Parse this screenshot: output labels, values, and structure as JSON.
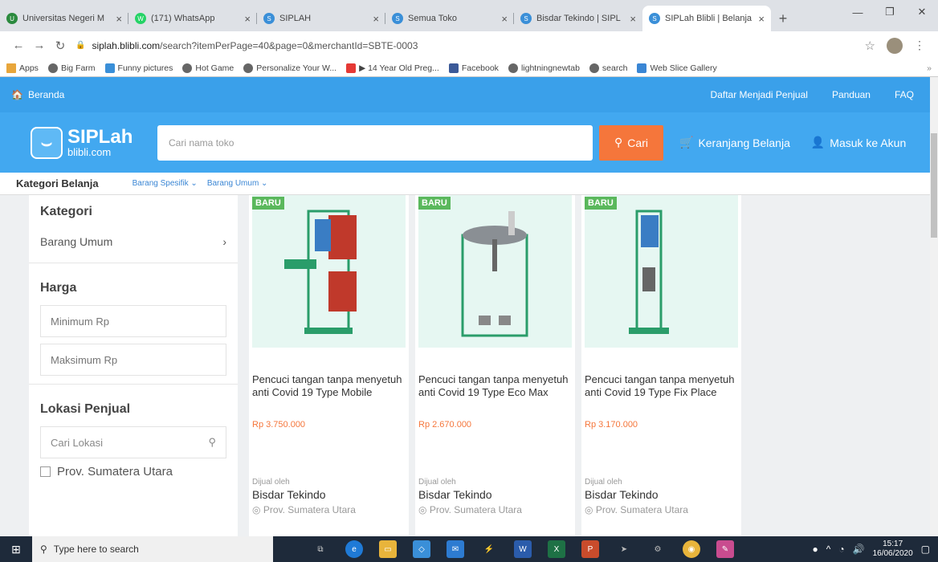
{
  "tabs": [
    {
      "title": "Universitas Negeri M",
      "color": "#2b8a3e",
      "active": false
    },
    {
      "title": "(171) WhatsApp",
      "color": "#25d366",
      "active": false
    },
    {
      "title": "SIPLAH",
      "color": "#3a8fd8",
      "active": false
    },
    {
      "title": "Semua Toko",
      "color": "#3a8fd8",
      "active": false
    },
    {
      "title": "Bisdar Tekindo | SIPL",
      "color": "#3a8fd8",
      "active": false
    },
    {
      "title": "SIPLah Blibli | Belanja",
      "color": "#3a8fd8",
      "active": true
    }
  ],
  "address": {
    "host": "siplah.blibli.com",
    "path": "/search?itemPerPage=40&page=0&merchantId=SBTE-0003"
  },
  "bookmarks": [
    {
      "label": "Apps",
      "color": "#888"
    },
    {
      "label": "Big Farm",
      "color": "#666"
    },
    {
      "label": "Funny pictures",
      "color": "#3a8fd8"
    },
    {
      "label": "Hot Game",
      "color": "#666"
    },
    {
      "label": "Personalize Your W...",
      "color": "#666"
    },
    {
      "label": "▶ 14 Year Old Preg...",
      "color": "#e53935"
    },
    {
      "label": "Facebook",
      "color": "#3b5998"
    },
    {
      "label": "lightningnewtab",
      "color": "#666"
    },
    {
      "label": "search",
      "color": "#666"
    },
    {
      "label": "Web Slice Gallery",
      "color": "#3a86d4"
    }
  ],
  "topnav": {
    "home": "Beranda",
    "links": [
      "Daftar Menjadi Penjual",
      "Panduan",
      "FAQ"
    ]
  },
  "header": {
    "logo_big": "SIPLah",
    "logo_small": "blibli.com",
    "search_placeholder": "Cari nama toko",
    "cari": "Cari",
    "cart": "Keranjang Belanja",
    "login": "Masuk ke Akun"
  },
  "catbar": {
    "title": "Kategori Belanja",
    "dd1": "Barang Spesifik",
    "dd2": "Barang Umum"
  },
  "sidebar": {
    "kategori_title": "Kategori",
    "kategori_item": "Barang Umum",
    "harga_title": "Harga",
    "min_placeholder": "Minimum Rp",
    "max_placeholder": "Maksimum Rp",
    "lokasi_title": "Lokasi Penjual",
    "lokasi_placeholder": "Cari Lokasi",
    "province": "Prov. Sumatera Utara"
  },
  "products": [
    {
      "badge": "BARU",
      "name": "Pencuci tangan tanpa menyetuh anti Covid 19 Type Mobile",
      "price": "Rp 3.750.000",
      "seller_label": "Dijual oleh",
      "seller": "Bisdar Tekindo",
      "location": "Prov. Sumatera Utara"
    },
    {
      "badge": "BARU",
      "name": "Pencuci tangan tanpa menyetuh anti Covid 19 Type Eco Max",
      "price": "Rp 2.670.000",
      "seller_label": "Dijual oleh",
      "seller": "Bisdar Tekindo",
      "location": "Prov. Sumatera Utara"
    },
    {
      "badge": "BARU",
      "name": "Pencuci tangan tanpa menyetuh anti Covid 19 Type Fix Place",
      "price": "Rp 3.170.000",
      "seller_label": "Dijual oleh",
      "seller": "Bisdar Tekindo",
      "location": "Prov. Sumatera Utara"
    }
  ],
  "taskbar": {
    "search_placeholder": "Type here to search",
    "time": "15:17",
    "date": "16/06/2020"
  },
  "colors": {
    "primary": "#42a8f0",
    "cari": "#f5763b",
    "badge": "#5ab85c"
  }
}
